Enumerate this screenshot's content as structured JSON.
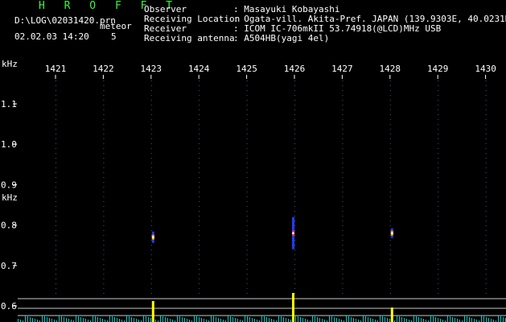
{
  "header": {
    "app_title": "H R O F F T",
    "file_path": "D:\\LOG\\02031420.prn",
    "mode_label": "meteor",
    "datetime": "02.02.03 14:20",
    "count": "5"
  },
  "info": [
    {
      "label": "Observer",
      "value": ": Masayuki Kobayashi"
    },
    {
      "label": "Receiving Location",
      "value": ": Ogata-vill. Akita-Pref. JAPAN (139.9303E, 40.0231N)"
    },
    {
      "label": "Receiver",
      "value": ": ICOM IC-706mkII 53.74918(@LCD)MHz USB"
    },
    {
      "label": "Receiving antenna",
      "value": ": A504HB(yagi 4el)"
    }
  ],
  "axis": {
    "y_unit_top": "kHz",
    "y_unit_mid": "kHz",
    "time_ticks": [
      "1421",
      "1422",
      "1423",
      "1424",
      "1425",
      "1426",
      "1427",
      "1428",
      "1429",
      "1430"
    ],
    "freq_ticks": [
      "1.1",
      "1.0",
      "0.9",
      "0.8",
      "0.7",
      "0.6"
    ]
  },
  "colors": {
    "background": "#000000",
    "title": "#3ef53e",
    "text": "#ffffff",
    "dot": "#4a4f8a",
    "trace": "#ffff00",
    "baseline": "#00cccc"
  },
  "events": [
    {
      "time": "1423",
      "freq_khz": 0.77,
      "intensity": "medium"
    },
    {
      "time": "1426",
      "freq_khz": 0.78,
      "intensity": "high"
    },
    {
      "time": "1428",
      "freq_khz": 0.78,
      "intensity": "low"
    }
  ]
}
